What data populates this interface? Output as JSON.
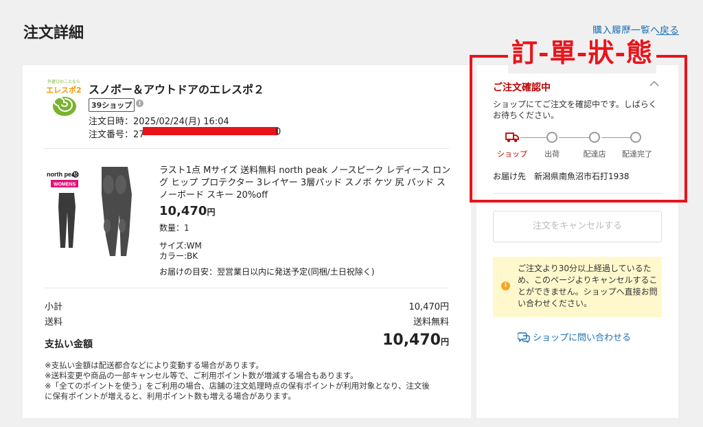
{
  "page": {
    "title": "注文詳細",
    "back_link": "購入履歴一覧へ戻る"
  },
  "annotation": {
    "label": "訂-單-狀-態",
    "color": "#e8141b"
  },
  "shop": {
    "logo_tagline": "外遊びのことなら",
    "logo_name": "エレスポ2",
    "name": "スノボー＆アウトドアのエレスポ２",
    "badge": "39ショップ",
    "order_date": "注文日時：2025/02/24(月) 16:04",
    "order_number_prefix": "注文番号：27",
    "order_number_suffix": "0"
  },
  "product": {
    "brand": "north peak",
    "brand_sub": "WOMENS",
    "title": "ラスト1点 Mサイズ 送料無料 north peak ノースピーク レディース ロング ヒップ プロテクター 3レイヤー 3層パッド スノボ ケツ 尻 パッド スノーボード スキー 20%off",
    "price": "10,470",
    "currency": "円",
    "quantity": "数量：1",
    "size": "サイズ:WM",
    "color": "カラー:BK",
    "delivery_estimate": "お届けの目安：翌営業日以内に発送予定(同梱/土日祝除く)"
  },
  "summary": {
    "subtotal_label": "小計",
    "subtotal_value": "10,470円",
    "shipping_label": "送料",
    "shipping_value": "送料無料",
    "total_label": "支払い金額",
    "total_value": "10,470",
    "currency": "円"
  },
  "notes": [
    "※支払い金額は配送都合などにより変動する場合があります。",
    "※送料変更や商品の一部キャンセル等で、ご利用ポイント数が増減する場合もあります。",
    "※「全てのポイントを使う」をご利用の場合、店舗の注文処理時点の保有ポイントが利用対象となり、注文後",
    "に保有ポイントが増えると、利用ポイント数も増える場合があります。"
  ],
  "status": {
    "title": "ご注文確認中",
    "message": "ショップにてご注文を確認中です。しばらくお待ちください。",
    "steps": [
      "ショップ",
      "出荷",
      "配達店",
      "配達完了"
    ],
    "active_step": 0,
    "delivery_address": "お届け先　新潟県南魚沼市石打1938",
    "accent_color": "#bf0000"
  },
  "actions": {
    "cancel_label": "注文をキャンセルする",
    "notice": "ご注文より30分以上経過しているため、このページよりキャンセルすることができません。ショップへ直接お問い合わせください。",
    "contact_label": "ショップに問い合わせる"
  }
}
